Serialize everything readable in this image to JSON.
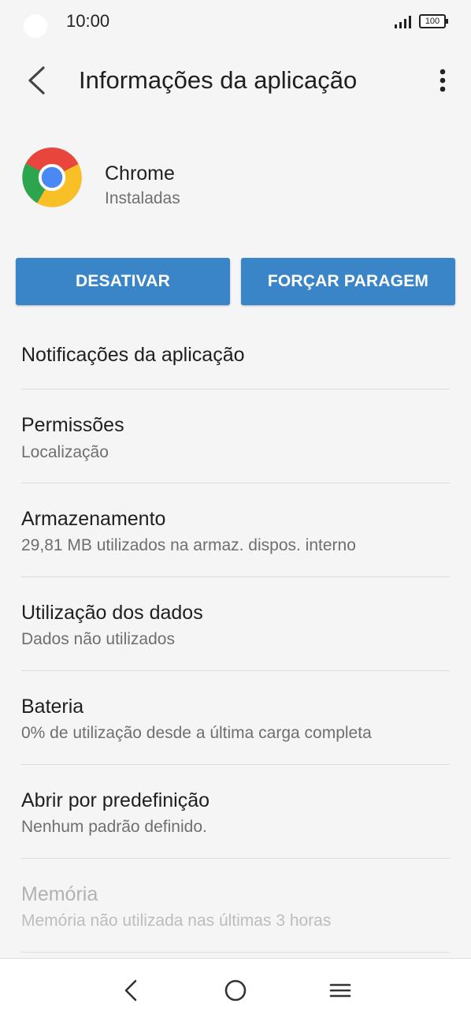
{
  "status_bar": {
    "time": "10:00",
    "battery": "100",
    "icons": [
      "signal-icon",
      "battery-icon"
    ]
  },
  "toolbar": {
    "title": "Informações da aplicação",
    "icons": [
      "back-arrow-icon",
      "more-vert-icon"
    ]
  },
  "app": {
    "name": "Chrome",
    "status": "Instaladas",
    "icon": "chrome-logo-icon"
  },
  "buttons": {
    "disable": "DESATIVAR",
    "force_stop": "FORÇAR PARAGEM"
  },
  "items": [
    {
      "label": "Notificações da aplicação",
      "sub": ""
    },
    {
      "label": "Permissões",
      "sub": "Localização"
    },
    {
      "label": "Armazenamento",
      "sub": "29,81 MB utilizados na armaz. dispos. interno"
    },
    {
      "label": "Utilização dos dados",
      "sub": "Dados não utilizados"
    },
    {
      "label": "Bateria",
      "sub": "0% de utilização desde a última carga completa"
    },
    {
      "label": "Abrir por predefinição",
      "sub": "Nenhum padrão definido."
    },
    {
      "label": "Memória",
      "sub": "Memória não utilizada nas últimas 3 horas"
    }
  ],
  "nav_bar": {
    "icons": [
      "nav-back-icon",
      "nav-home-icon",
      "nav-recents-icon"
    ]
  },
  "colors": {
    "accent": "#3a85c8",
    "background": "#f5f5f5",
    "disabled_text": "#b2b2b2"
  }
}
